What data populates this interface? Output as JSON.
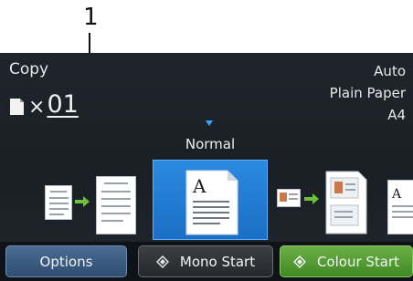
{
  "callout": {
    "number": "1"
  },
  "header": {
    "title": "Copy",
    "copies": "01",
    "copies_prefix": "×"
  },
  "status": {
    "quality": "Auto",
    "paper_type": "Plain Paper",
    "paper_size": "A4"
  },
  "carousel": {
    "selected_label": "Normal"
  },
  "buttons": {
    "options": "Options",
    "mono_start": "Mono Start",
    "colour_start": "Colour Start"
  },
  "colors": {
    "screen_bg": "#1c2127",
    "accent_blue": "#2b8ae0",
    "start_green": "#4f9a2e"
  }
}
